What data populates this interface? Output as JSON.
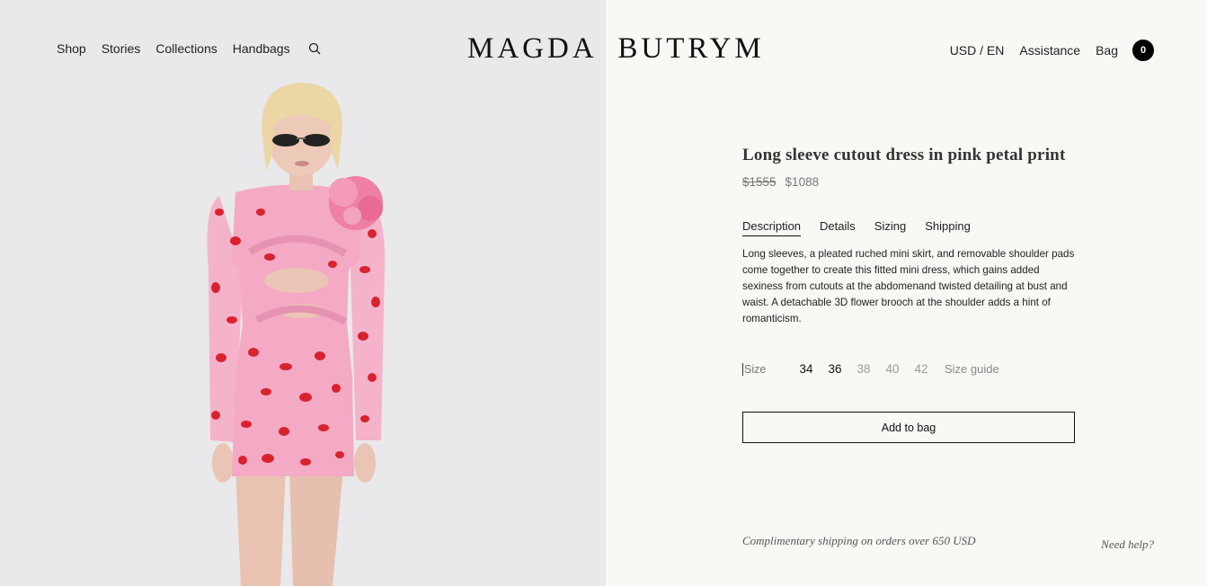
{
  "header": {
    "nav_left": [
      "Shop",
      "Stories",
      "Collections",
      "Handbags"
    ],
    "logo": "MAGDA  BUTRYM",
    "currency_language": "USD / EN",
    "assistance": "Assistance",
    "bag": "Bag",
    "bag_count": "0"
  },
  "product": {
    "title": "Long sleeve cutout dress in pink petal print",
    "price_old": "$1555",
    "price_new": "$1088",
    "tabs": [
      "Description",
      "Details",
      "Sizing",
      "Shipping"
    ],
    "active_tab": "Description",
    "description": "Long sleeves, a pleated ruched mini skirt, and removable shoulder pads come together to create this fitted mini dress, which gains added sexiness from cutouts at the abdomenand twisted detailing at bust and waist. A detachable 3D flower brooch at the shoulder adds a hint of romanticism.",
    "size_label": "Size",
    "sizes": [
      {
        "label": "34",
        "available": true
      },
      {
        "label": "36",
        "available": true
      },
      {
        "label": "38",
        "available": false
      },
      {
        "label": "40",
        "available": false
      },
      {
        "label": "42",
        "available": false
      }
    ],
    "size_guide": "Size guide",
    "add_to_bag": "Add to bag"
  },
  "footer": {
    "shipping_note": "Complimentary shipping on orders over 650 USD",
    "need_help": "Need help?"
  },
  "colors": {
    "image_bg": "#e9e8ea",
    "panel_bg": "#f9f8f5",
    "dress_pink": "#f2a9c4",
    "petal_red": "#d8232f"
  }
}
